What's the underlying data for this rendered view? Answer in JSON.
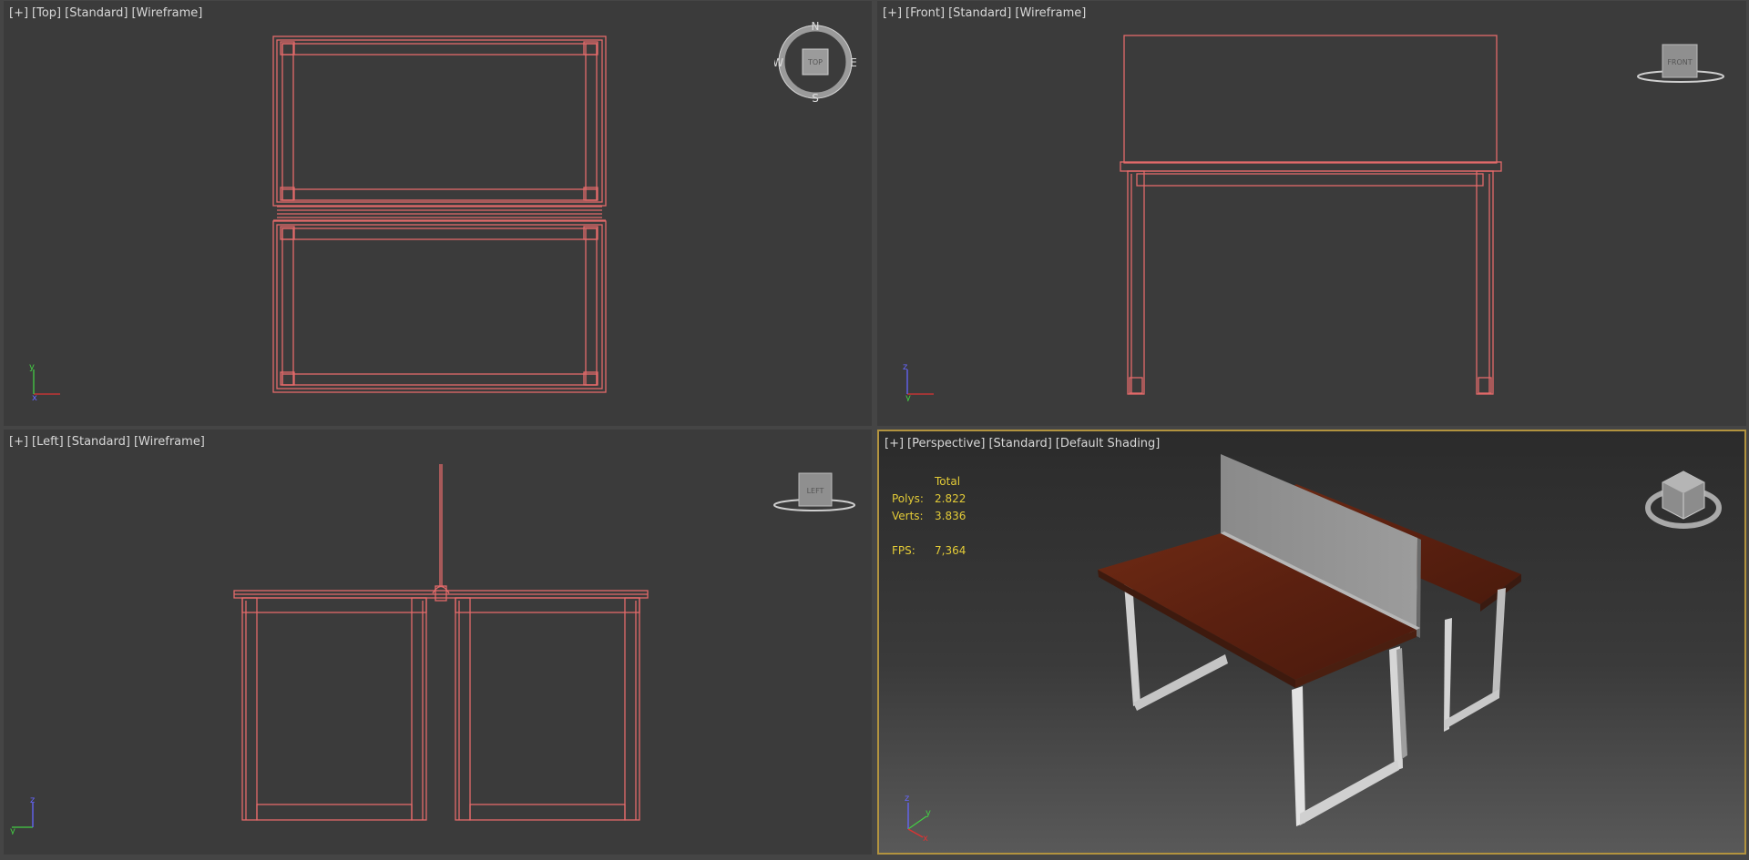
{
  "viewports": {
    "top": {
      "labels": [
        "[+]",
        "[Top]",
        "[Standard]",
        "[Wireframe]"
      ],
      "nav": {
        "cube": "TOP",
        "north": "N",
        "south": "S",
        "east": "E",
        "west": "W"
      },
      "axes": {
        "a": "y",
        "b": "x"
      }
    },
    "front": {
      "labels": [
        "[+]",
        "[Front]",
        "[Standard]",
        "[Wireframe]"
      ],
      "nav": {
        "cube": "FRONT"
      },
      "axes": {
        "a": "z",
        "b": "y"
      }
    },
    "left": {
      "labels": [
        "[+]",
        "[Left]",
        "[Standard]",
        "[Wireframe]"
      ],
      "nav": {
        "cube": "LEFT"
      },
      "axes": {
        "a": "z",
        "b": "y"
      }
    },
    "perspective": {
      "labels": [
        "[+]",
        "[Perspective]",
        "[Standard]",
        "[Default Shading]"
      ],
      "stats": {
        "header": "Total",
        "polys_label": "Polys:",
        "polys_value": "2.822",
        "verts_label": "Verts:",
        "verts_value": "3.836",
        "fps_label": "FPS:",
        "fps_value": "7,364"
      },
      "axes": {
        "a": "z",
        "b": "y",
        "c": "x"
      }
    }
  },
  "colors": {
    "wireframe": "#e36a6a",
    "active_border": "#b2933f",
    "stats_text": "#e3cb37",
    "viewport_bg": "#3b3b3b"
  }
}
